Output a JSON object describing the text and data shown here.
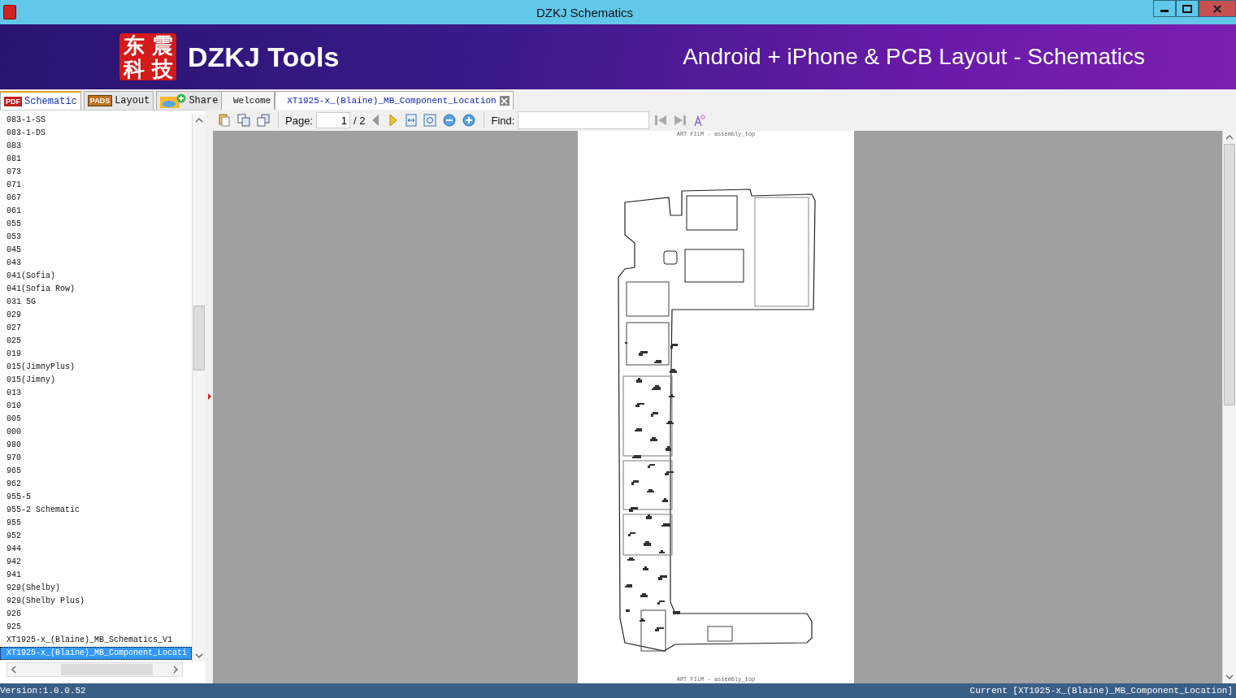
{
  "window": {
    "title": "DZKJ Schematics"
  },
  "banner": {
    "logo_text": "东震科技",
    "brand": "DZKJ Tools",
    "slogan": "Android + iPhone & PCB Layout - Schematics"
  },
  "side_tabs": [
    {
      "label": "Schematic",
      "badge": "PDF",
      "kind": "pdf",
      "selected": true
    },
    {
      "label": "Layout",
      "badge": "PADS",
      "kind": "pads",
      "selected": false
    },
    {
      "label": "Share",
      "kind": "cloud",
      "selected": false
    }
  ],
  "file_list": [
    {
      "label": "083-1-SS",
      "selected": false
    },
    {
      "label": "083-1-DS",
      "selected": false
    },
    {
      "label": "083",
      "selected": false
    },
    {
      "label": "081",
      "selected": false
    },
    {
      "label": "073",
      "selected": false
    },
    {
      "label": "071",
      "selected": false
    },
    {
      "label": "067",
      "selected": false
    },
    {
      "label": "061",
      "selected": false
    },
    {
      "label": "055",
      "selected": false
    },
    {
      "label": "053",
      "selected": false
    },
    {
      "label": "045",
      "selected": false
    },
    {
      "label": "043",
      "selected": false
    },
    {
      "label": "041(Sofia)",
      "selected": false
    },
    {
      "label": "041(Sofia Row)",
      "selected": false
    },
    {
      "label": "031 5G",
      "selected": false
    },
    {
      "label": "029",
      "selected": false
    },
    {
      "label": "027",
      "selected": false
    },
    {
      "label": "025",
      "selected": false
    },
    {
      "label": "019",
      "selected": false
    },
    {
      "label": "015(JimnyPlus)",
      "selected": false
    },
    {
      "label": "015(Jimny)",
      "selected": false
    },
    {
      "label": "013",
      "selected": false
    },
    {
      "label": "010",
      "selected": false
    },
    {
      "label": "005",
      "selected": false
    },
    {
      "label": "000",
      "selected": false
    },
    {
      "label": "980",
      "selected": false
    },
    {
      "label": "970",
      "selected": false
    },
    {
      "label": "965",
      "selected": false
    },
    {
      "label": "962",
      "selected": false
    },
    {
      "label": "955-5",
      "selected": false
    },
    {
      "label": "955-2 Schematic",
      "selected": false
    },
    {
      "label": "955",
      "selected": false
    },
    {
      "label": "952",
      "selected": false
    },
    {
      "label": "944",
      "selected": false
    },
    {
      "label": "942",
      "selected": false
    },
    {
      "label": "941",
      "selected": false
    },
    {
      "label": "929(Shelby)",
      "selected": false
    },
    {
      "label": "929(Shelby Plus)",
      "selected": false
    },
    {
      "label": "926",
      "selected": false
    },
    {
      "label": "925",
      "selected": false
    },
    {
      "label": "XT1925-x_(Blaine)_MB_Schematics_V1",
      "selected": false
    },
    {
      "label": "XT1925-x_(Blaine)_MB_Component_Locati",
      "selected": true
    }
  ],
  "doc_tabs": [
    {
      "label": "Welcome",
      "selected": false,
      "closable": false
    },
    {
      "label": "XT1925-x_(Blaine)_MB_Component_Location",
      "selected": true,
      "closable": true
    }
  ],
  "toolbar": {
    "page_label": "Page:",
    "page_value": "1",
    "page_total": "/ 2",
    "find_label": "Find:"
  },
  "document": {
    "header": "ART FILM - assembly_top",
    "footer": "ART FILM - assembly_top"
  },
  "status_bar": {
    "version": "Version:1.0.0.52",
    "current": "Current [XT1925-x_(Blaine)_MB_Component_Location]"
  }
}
